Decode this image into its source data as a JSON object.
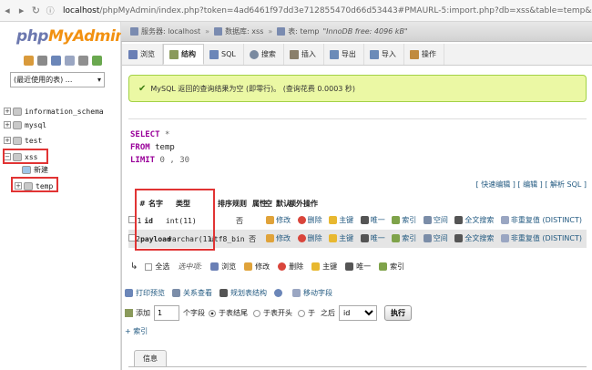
{
  "address": {
    "host": "localhost",
    "path": "/phpMyAdmin/index.php?token=4ad6461f97dd3e712855470d66d53443#PMAURL-5:import.php?db=xss&table=temp&server=1&target=&token"
  },
  "left": {
    "logo_php": "php",
    "logo_my": "MyAdmin",
    "recent_select": "(最近使用的表) ...",
    "tree": [
      {
        "sign": "+",
        "label": "information_schema"
      },
      {
        "sign": "+",
        "label": "mysql"
      },
      {
        "sign": "+",
        "label": "test"
      },
      {
        "sign": "−",
        "label": "xss"
      },
      {
        "sign": "",
        "label": "新建"
      },
      {
        "sign": "+",
        "label": "temp"
      }
    ]
  },
  "main": {
    "breadcrumb": {
      "server": "服务器: localhost",
      "db": "数据库: xss",
      "table": "表: temp",
      "table_info": "\"InnoDB free: 4096 kB\""
    },
    "tabs": [
      {
        "label": "浏览",
        "color": "#6a7fb5"
      },
      {
        "label": "结构",
        "color": "#8a9a5b"
      },
      {
        "label": "SQL",
        "color": "#6b86b8"
      },
      {
        "label": "搜索",
        "color": "#7a8aa0"
      },
      {
        "label": "插入",
        "color": "#8a7f6a"
      },
      {
        "label": "导出",
        "color": "#6b8bb8"
      },
      {
        "label": "导入",
        "color": "#6b8bb8"
      },
      {
        "label": "操作",
        "color": "#c08a3e"
      }
    ],
    "success_text": "MySQL 返回的查询结果为空 (即零行)。 (查询花费 0.0003 秒)",
    "sql": {
      "select": "SELECT",
      "star": "*",
      "from": "FROM",
      "table": "temp",
      "limit": "LIMIT",
      "limit_val": "0 , 30"
    },
    "edit_links": {
      "inline": "[ 快速编辑 ]",
      "edit": "[ 编辑 ]",
      "explain": "[ 解析 SQL ]"
    },
    "table_header": {
      "num": "#",
      "name": "名字",
      "type": "类型",
      "collation": "排序规则",
      "attr": "属性",
      "null": "空",
      "default": "默认",
      "extra": "额外",
      "action": "操作"
    },
    "rows": [
      {
        "num": "1",
        "name": "id",
        "type": "int(11)",
        "collation": "",
        "null": "否",
        "actions": [
          "修改",
          "删除",
          "主键",
          "唯一",
          "索引",
          "空间",
          "全文搜索",
          "非重复值 (DISTINCT)"
        ]
      },
      {
        "num": "2",
        "name": "payload",
        "type": "varchar(11)",
        "collation": "utf8_bin",
        "null": "否",
        "actions": [
          "修改",
          "删除",
          "主键",
          "唯一",
          "索引",
          "空间",
          "全文搜索",
          "非重复值 (DISTINCT)"
        ]
      }
    ],
    "bulk": {
      "select_all": "全选",
      "with_selected": "选中项:",
      "items": [
        "浏览",
        "修改",
        "删除",
        "主键",
        "唯一",
        "索引"
      ]
    },
    "print_row": [
      "打印预览",
      "关系查看",
      "规划表结构",
      "移动字段"
    ],
    "add_row": {
      "add": "添加",
      "count": "1",
      "fields": "个字段",
      "at_end": "于表结尾",
      "at_begin": "于表开头",
      "after": "于",
      "after_suffix": "之后",
      "after_select": "id",
      "go": "执行"
    },
    "index_link": "+ 索引",
    "info_tab": "信息"
  }
}
